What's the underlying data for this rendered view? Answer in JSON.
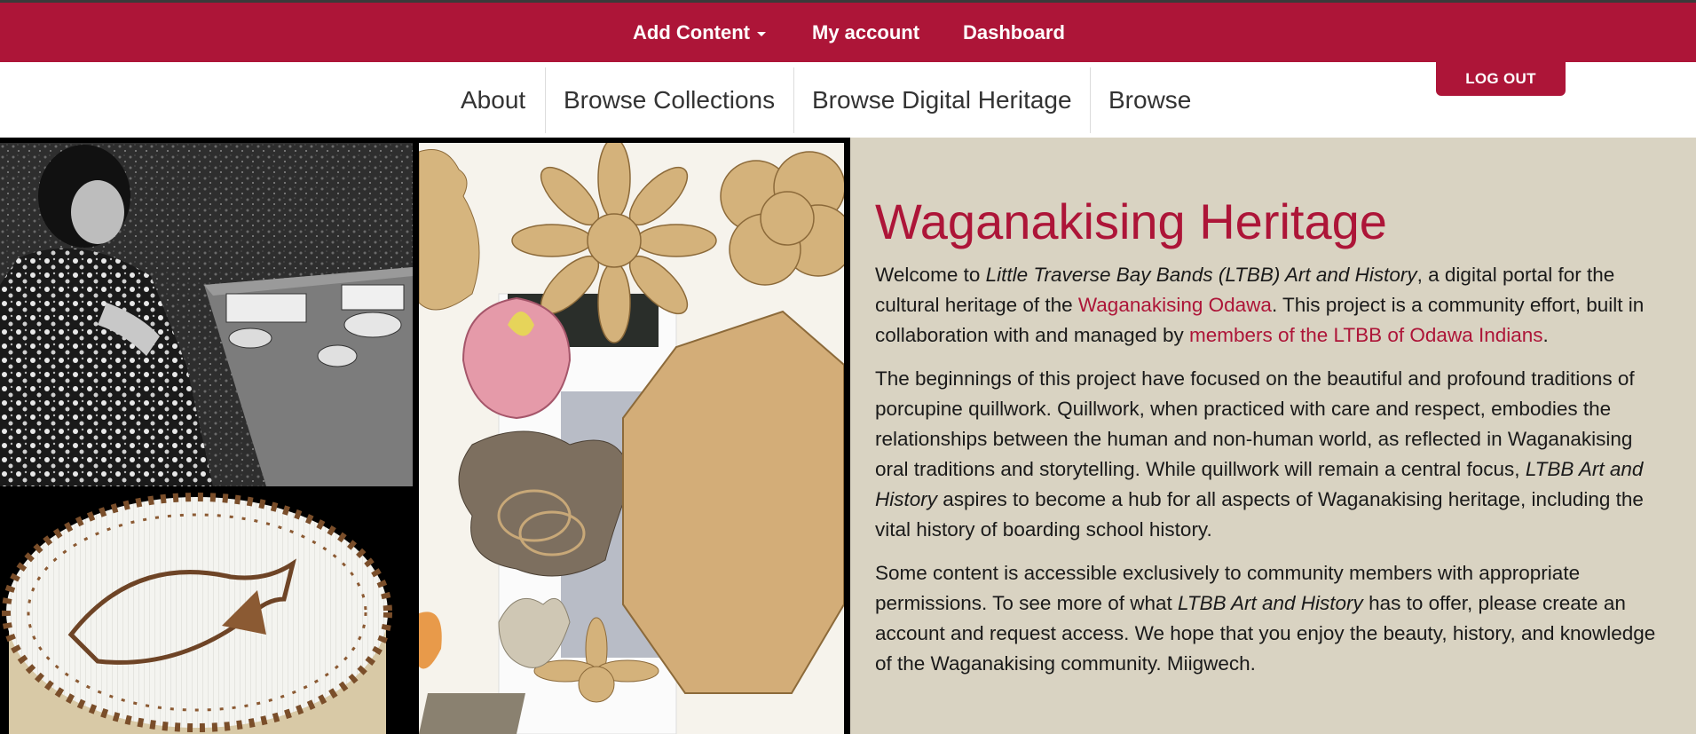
{
  "admin_bar": {
    "add_content": "Add Content",
    "my_account": "My account",
    "dashboard": "Dashboard"
  },
  "nav": {
    "about": "About",
    "browse_collections": "Browse Collections",
    "browse_digital_heritage": "Browse Digital Heritage",
    "browse": "Browse",
    "logout": "LOG OUT"
  },
  "hero": {
    "title": "Waganakising Heritage",
    "p1": {
      "t1": "Welcome to ",
      "em1": "Little Traverse Bay Bands (LTBB) Art and History",
      "t2": ", a digital portal for the cultural heritage of the ",
      "link1": "Waganakising Odawa",
      "t3": ". This project is a community effort, built in collaboration with and managed by ",
      "link2": "members of the LTBB of Odawa Indians",
      "t4": "."
    },
    "p2": {
      "t1": "The beginnings of this project have focused on the beautiful and profound traditions of porcupine quillwork. Quillwork, when practiced with care and respect, embodies the relationships between the human and non-human world, as reflected in Waganakising oral traditions and storytelling. While quillwork will remain a central focus, ",
      "em1": "LTBB Art and History",
      "t2": " aspires to become a hub for all aspects of Waganakising heritage, including the vital history of boarding school history."
    },
    "p3": {
      "t1": "Some content is accessible exclusively to community members with appropriate permissions. To see more of what ",
      "em1": "LTBB Art and History",
      "t2": " has to offer, please create an account and request access. We hope that you enjoy the beauty, history, and knowledge of the Waganakising community. Miigwech."
    }
  },
  "colors": {
    "brand": "#ad1538",
    "intro_background": "#d9d3c2",
    "collage_background": "#000000"
  }
}
